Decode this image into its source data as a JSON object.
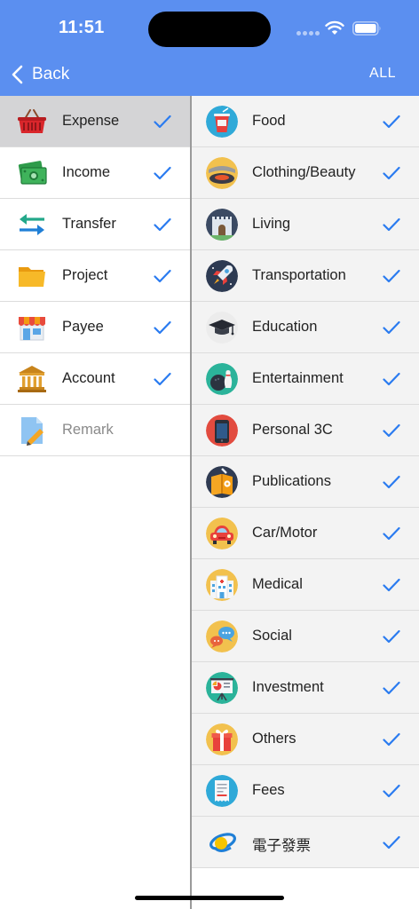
{
  "status_bar": {
    "time": "11:51"
  },
  "nav": {
    "back_label": "Back",
    "all_label": "ALL"
  },
  "colors": {
    "header": "#5b8ff0",
    "check": "#2a7bf0",
    "selected_row": "#d4d4d6"
  },
  "left_menu": [
    {
      "label": "Expense",
      "icon": "basket-icon",
      "checked": true,
      "selected": true
    },
    {
      "label": "Income",
      "icon": "money-icon",
      "checked": true
    },
    {
      "label": "Transfer",
      "icon": "transfer-arrows-icon",
      "checked": true
    },
    {
      "label": "Project",
      "icon": "folder-icon",
      "checked": true
    },
    {
      "label": "Payee",
      "icon": "store-icon",
      "checked": true
    },
    {
      "label": "Account",
      "icon": "bank-icon",
      "checked": true
    },
    {
      "label": "Remark",
      "icon": "note-pencil-icon",
      "checked": false
    }
  ],
  "categories": [
    {
      "label": "Food",
      "icon": "drink-icon"
    },
    {
      "label": "Clothing/Beauty",
      "icon": "hat-icon"
    },
    {
      "label": "Living",
      "icon": "house-icon"
    },
    {
      "label": "Transportation",
      "icon": "rocket-icon"
    },
    {
      "label": "Education",
      "icon": "graduation-cap-icon"
    },
    {
      "label": "Entertainment",
      "icon": "bowling-icon"
    },
    {
      "label": "Personal 3C",
      "icon": "phone-icon"
    },
    {
      "label": "Publications",
      "icon": "book-icon"
    },
    {
      "label": "Car/Motor",
      "icon": "car-icon"
    },
    {
      "label": "Medical",
      "icon": "hospital-icon"
    },
    {
      "label": "Social",
      "icon": "chat-bubbles-icon"
    },
    {
      "label": "Investment",
      "icon": "presentation-chart-icon"
    },
    {
      "label": "Others",
      "icon": "gift-icon"
    },
    {
      "label": "Fees",
      "icon": "receipt-icon"
    },
    {
      "label": "電子發票",
      "icon": "e-invoice-icon"
    }
  ]
}
